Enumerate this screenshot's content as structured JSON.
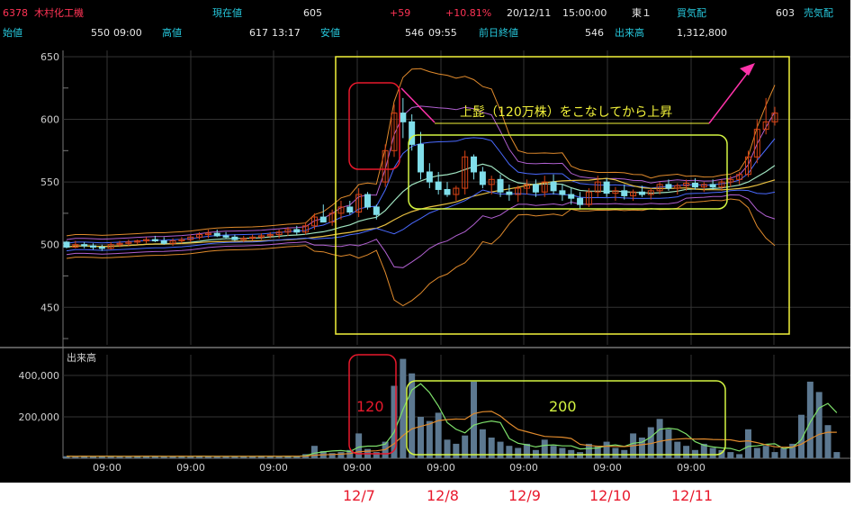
{
  "header": {
    "code": "6378",
    "name": "木村化工機",
    "current_label": "現在値",
    "current_value": "605",
    "change": "+59",
    "change_pct": "+10.81%",
    "date": "20/12/11",
    "time": "15:00:00",
    "market": "東１",
    "buy_label": "買気配",
    "buy_value": "603",
    "sell_label": "売気配",
    "open_label": "始値",
    "open_value": "550",
    "open_time": "09:00",
    "high_label": "高値",
    "high_value": "617",
    "high_time": "13:17",
    "low_label": "安値",
    "low_value": "546",
    "low_time": "09:55",
    "prev_close_label": "前日終値",
    "prev_close_value": "546",
    "volume_label": "出来高",
    "volume_value": "1,312,800"
  },
  "annotations": {
    "main_note": "上髭（120万株）をこなしてから上昇",
    "spike_volume": "120",
    "range_volume": "200"
  },
  "day_labels": [
    "12/7",
    "12/8",
    "12/9",
    "12/10",
    "12/11"
  ],
  "colors": {
    "background": "#000000",
    "grid": "#333333",
    "candle_up": "#d84315",
    "candle_down": "#80deea",
    "annotation_yellow": "#f2f23a",
    "annotation_red": "#e8192c",
    "annotation_lime": "#d4f542",
    "arrow_magenta": "#ff33aa"
  },
  "chart_data": [
    {
      "type": "candlestick",
      "title": "",
      "y_ticks": [
        450,
        500,
        550,
        600,
        650
      ],
      "ylim": [
        420,
        655
      ],
      "x_ticks": [
        "09:00",
        "09:00",
        "09:00",
        "09:00",
        "09:00",
        "09:00",
        "09:00",
        "09:00"
      ],
      "grid": true,
      "bars_per_day": 9,
      "candles": [
        [
          502,
          503,
          497,
          498
        ],
        [
          498,
          503,
          497,
          500
        ],
        [
          500,
          502,
          497,
          499
        ],
        [
          499,
          501,
          496,
          498
        ],
        [
          498,
          500,
          495,
          497
        ],
        [
          497,
          502,
          496,
          500
        ],
        [
          500,
          503,
          498,
          501
        ],
        [
          501,
          504,
          499,
          502
        ],
        [
          502,
          504,
          500,
          503
        ],
        [
          503,
          506,
          501,
          504
        ],
        [
          504,
          507,
          502,
          503
        ],
        [
          503,
          506,
          500,
          501
        ],
        [
          501,
          505,
          499,
          503
        ],
        [
          503,
          506,
          501,
          504
        ],
        [
          504,
          508,
          502,
          506
        ],
        [
          506,
          510,
          504,
          508
        ],
        [
          508,
          512,
          505,
          509
        ],
        [
          509,
          512,
          506,
          507
        ],
        [
          507,
          510,
          505,
          506
        ],
        [
          506,
          508,
          503,
          504
        ],
        [
          504,
          507,
          502,
          505
        ],
        [
          505,
          508,
          503,
          506
        ],
        [
          506,
          509,
          504,
          507
        ],
        [
          507,
          510,
          505,
          508
        ],
        [
          508,
          512,
          505,
          510
        ],
        [
          510,
          514,
          507,
          512
        ],
        [
          512,
          515,
          508,
          510
        ],
        [
          510,
          518,
          508,
          515
        ],
        [
          515,
          525,
          512,
          522
        ],
        [
          522,
          532,
          518,
          518
        ],
        [
          518,
          528,
          515,
          525
        ],
        [
          525,
          535,
          520,
          530
        ],
        [
          530,
          535,
          524,
          526
        ],
        [
          526,
          545,
          522,
          540
        ],
        [
          540,
          542,
          528,
          530
        ],
        [
          530,
          532,
          520,
          524
        ],
        [
          550,
          580,
          546,
          575
        ],
        [
          575,
          612,
          570,
          605
        ],
        [
          605,
          617,
          585,
          598
        ],
        [
          598,
          604,
          575,
          580
        ],
        [
          580,
          590,
          552,
          558
        ],
        [
          558,
          565,
          545,
          550
        ],
        [
          550,
          558,
          540,
          544
        ],
        [
          544,
          550,
          538,
          540
        ],
        [
          540,
          547,
          535,
          545
        ],
        [
          545,
          575,
          540,
          570
        ],
        [
          570,
          572,
          552,
          558
        ],
        [
          558,
          562,
          545,
          548
        ],
        [
          548,
          555,
          540,
          552
        ],
        [
          552,
          556,
          538,
          542
        ],
        [
          542,
          548,
          535,
          540
        ],
        [
          540,
          547,
          534,
          545
        ],
        [
          545,
          552,
          540,
          548
        ],
        [
          548,
          552,
          538,
          542
        ],
        [
          542,
          555,
          538,
          550
        ],
        [
          550,
          556,
          540,
          543
        ],
        [
          543,
          548,
          535,
          540
        ],
        [
          540,
          545,
          532,
          537
        ],
        [
          537,
          542,
          528,
          532
        ],
        [
          532,
          545,
          530,
          542
        ],
        [
          542,
          555,
          538,
          550
        ],
        [
          550,
          553,
          538,
          541
        ],
        [
          541,
          546,
          535,
          543
        ],
        [
          543,
          548,
          536,
          539
        ],
        [
          539,
          544,
          535,
          542
        ],
        [
          542,
          547,
          538,
          540
        ],
        [
          540,
          545,
          536,
          543
        ],
        [
          543,
          550,
          540,
          548
        ],
        [
          548,
          552,
          543,
          545
        ],
        [
          545,
          549,
          540,
          547
        ],
        [
          547,
          552,
          543,
          549
        ],
        [
          549,
          553,
          544,
          546
        ],
        [
          546,
          550,
          542,
          548
        ],
        [
          548,
          552,
          544,
          546
        ],
        [
          546,
          552,
          543,
          550
        ],
        [
          550,
          555,
          546,
          552
        ],
        [
          552,
          558,
          548,
          556
        ],
        [
          556,
          575,
          554,
          570
        ],
        [
          570,
          600,
          565,
          592
        ],
        [
          592,
          617,
          588,
          598
        ],
        [
          598,
          610,
          595,
          605
        ]
      ]
    },
    {
      "type": "bar",
      "title": "出来高",
      "y_ticks": [
        "200,000",
        "400,000"
      ],
      "ylim": [
        0,
        500000
      ],
      "x_ticks": [
        "09:00",
        "09:00",
        "09:00",
        "09:00",
        "09:00",
        "09:00",
        "09:00",
        "09:00"
      ],
      "values": [
        10000,
        8000,
        12000,
        9000,
        11000,
        8000,
        10000,
        9000,
        12000,
        9000,
        10000,
        8000,
        11000,
        9000,
        10000,
        12000,
        9000,
        8000,
        10000,
        9000,
        11000,
        8000,
        12000,
        9000,
        10000,
        11000,
        9000,
        20000,
        60000,
        35000,
        25000,
        30000,
        40000,
        120000,
        45000,
        30000,
        80000,
        350000,
        480000,
        410000,
        200000,
        180000,
        220000,
        90000,
        70000,
        110000,
        370000,
        140000,
        100000,
        80000,
        60000,
        50000,
        70000,
        40000,
        90000,
        60000,
        50000,
        40000,
        30000,
        70000,
        60000,
        80000,
        50000,
        40000,
        120000,
        100000,
        150000,
        190000,
        140000,
        80000,
        60000,
        40000,
        70000,
        50000,
        40000,
        30000,
        20000,
        140000,
        50000,
        60000,
        30000,
        50000,
        70000,
        210000,
        370000,
        320000,
        160000,
        30000
      ]
    }
  ]
}
